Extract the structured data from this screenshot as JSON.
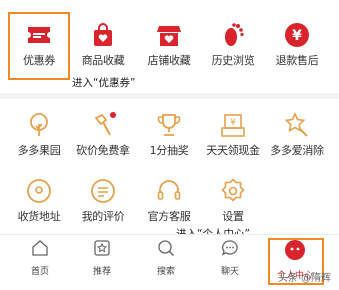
{
  "top_row": [
    {
      "label": "优惠券",
      "icon": "coupon-icon"
    },
    {
      "label": "商品收藏",
      "icon": "bag-heart-icon"
    },
    {
      "label": "店铺收藏",
      "icon": "shop-heart-icon"
    },
    {
      "label": "历史浏览",
      "icon": "footprint-icon"
    },
    {
      "label": "退款售后",
      "icon": "yen-refund-icon"
    }
  ],
  "middle_row": [
    {
      "label": "多多果园",
      "icon": "tree-icon"
    },
    {
      "label": "砍价免费拿",
      "icon": "axe-icon"
    },
    {
      "label": "1分抽奖",
      "icon": "trophy-icon"
    },
    {
      "label": "天天领现金",
      "icon": "cash-card-icon"
    },
    {
      "label": "多多爱消除",
      "icon": "star-wand-icon"
    }
  ],
  "bottom_row": [
    {
      "label": "收货地址",
      "icon": "location-icon"
    },
    {
      "label": "我的评价",
      "icon": "review-icon"
    },
    {
      "label": "官方客服",
      "icon": "headset-icon"
    },
    {
      "label": "设置",
      "icon": "settings-icon"
    }
  ],
  "annotations": {
    "coupon_note": "进入“优惠券”",
    "center_note": "进入“个人中心”"
  },
  "tabbar": [
    {
      "label": "首页",
      "icon": "home-icon"
    },
    {
      "label": "推荐",
      "icon": "recommend-icon"
    },
    {
      "label": "搜索",
      "icon": "search-icon"
    },
    {
      "label": "聊天",
      "icon": "chat-icon"
    },
    {
      "label": "个人中心",
      "icon": "profile-icon",
      "active": true
    }
  ],
  "watermark": "头条 @隋辉",
  "colors": {
    "accent_red": "#d9232d",
    "icon_orange": "#e8a04a",
    "highlight_border": "#f08a24"
  }
}
